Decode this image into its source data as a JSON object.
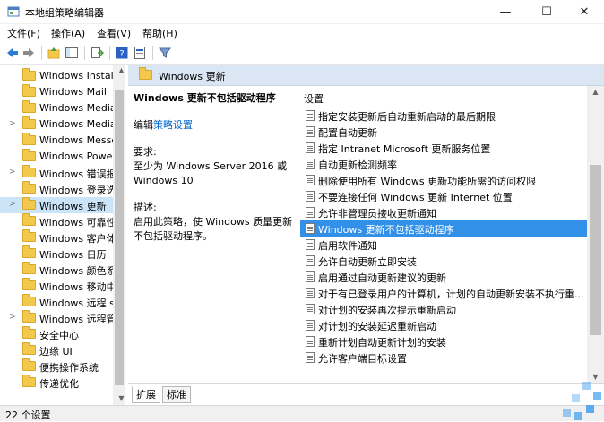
{
  "window": {
    "title": "本地组策略编辑器",
    "minimize": "—",
    "maximize": "☐",
    "close": "✕"
  },
  "menu": [
    "文件(F)",
    "操作(A)",
    "查看(V)",
    "帮助(H)"
  ],
  "tree": {
    "items": [
      {
        "label": "Windows Installer",
        "expander": "",
        "selected": false
      },
      {
        "label": "Windows Mail",
        "expander": "",
        "selected": false
      },
      {
        "label": "Windows Media Center",
        "expander": "",
        "selected": false
      },
      {
        "label": "Windows Media Player",
        "expander": ">",
        "selected": false
      },
      {
        "label": "Windows Messenger",
        "expander": "",
        "selected": false
      },
      {
        "label": "Windows PowerShell",
        "expander": "",
        "selected": false
      },
      {
        "label": "Windows 错误报告",
        "expander": ">",
        "selected": false
      },
      {
        "label": "Windows 登录选项",
        "expander": "",
        "selected": false
      },
      {
        "label": "Windows 更新",
        "expander": ">",
        "selected": true
      },
      {
        "label": "Windows 可靠性分析",
        "expander": "",
        "selected": false
      },
      {
        "label": "Windows 客户体验改善计划",
        "expander": "",
        "selected": false
      },
      {
        "label": "Windows 日历",
        "expander": "",
        "selected": false
      },
      {
        "label": "Windows 颜色系统",
        "expander": "",
        "selected": false
      },
      {
        "label": "Windows 移动中心",
        "expander": "",
        "selected": false
      },
      {
        "label": "Windows 远程 shell",
        "expander": "",
        "selected": false
      },
      {
        "label": "Windows 远程管理(Windows Remote Management)",
        "expander": ">",
        "selected": false
      },
      {
        "label": "安全中心",
        "expander": "",
        "selected": false
      },
      {
        "label": "边缘 UI",
        "expander": "",
        "selected": false
      },
      {
        "label": "便携操作系统",
        "expander": "",
        "selected": false
      },
      {
        "label": "传递优化",
        "expander": "",
        "selected": false
      }
    ]
  },
  "content": {
    "header_title": "Windows 更新",
    "description": {
      "title": "Windows 更新不包括驱动程序",
      "edit_prefix": "编辑",
      "edit_link": "策略设置",
      "requirements_label": "要求:",
      "requirements": "至少为 Windows Server 2016 或 Windows 10",
      "description_label": "描述:",
      "description": "启用此策略，使 Windows 质量更新不包括驱动程序。"
    },
    "list_header": "设置",
    "items": [
      {
        "label": "指定安装更新后自动重新启动的最后期限",
        "selected": false
      },
      {
        "label": "配置自动更新",
        "selected": false
      },
      {
        "label": "指定 Intranet Microsoft 更新服务位置",
        "selected": false
      },
      {
        "label": "自动更新检测频率",
        "selected": false
      },
      {
        "label": "删除使用所有 Windows 更新功能所需的访问权限",
        "selected": false
      },
      {
        "label": "不要连接任何 Windows 更新 Internet 位置",
        "selected": false
      },
      {
        "label": "允许非管理员接收更新通知",
        "selected": false
      },
      {
        "label": "Windows 更新不包括驱动程序",
        "selected": true
      },
      {
        "label": "启用软件通知",
        "selected": false
      },
      {
        "label": "允许自动更新立即安装",
        "selected": false
      },
      {
        "label": "启用通过自动更新建议的更新",
        "selected": false
      },
      {
        "label": "对于有已登录用户的计算机，计划的自动更新安装不执行重...",
        "selected": false
      },
      {
        "label": "对计划的安装再次提示重新启动",
        "selected": false
      },
      {
        "label": "对计划的安装延迟重新启动",
        "selected": false
      },
      {
        "label": "重新计划自动更新计划的安装",
        "selected": false
      },
      {
        "label": "允许客户端目标设置",
        "selected": false
      }
    ],
    "tabs": [
      {
        "label": "扩展",
        "active": true
      },
      {
        "label": "标准",
        "active": false
      }
    ]
  },
  "status": {
    "text": "22 个设置"
  }
}
